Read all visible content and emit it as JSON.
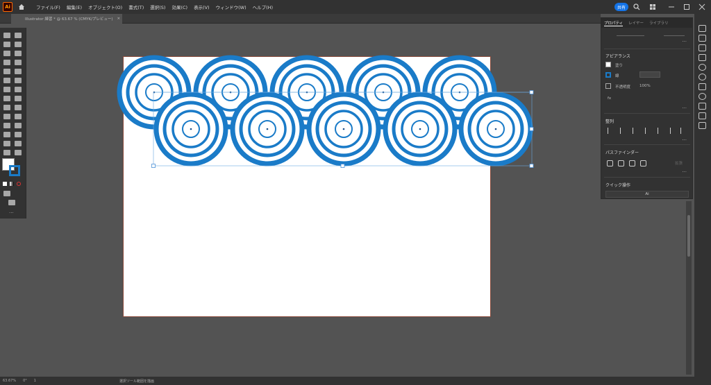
{
  "app": {
    "logo": "Ai"
  },
  "menu": {
    "items": [
      "ファイル(F)",
      "編集(E)",
      "オブジェクト(O)",
      "書式(T)",
      "選択(S)",
      "効果(C)",
      "表示(V)",
      "ウィンドウ(W)",
      "ヘルプ(H)"
    ]
  },
  "topbar": {
    "share_label": "共有",
    "search_icon": "search-icon"
  },
  "tab": {
    "title": "Illustrator 練習 * @ 63.67 % (CMYK/プレビュー)",
    "close": "×"
  },
  "panel": {
    "tabs": [
      "プロパティ",
      "レイヤー",
      "ライブラリ"
    ],
    "appearance_title": "アピアランス",
    "fill_label": "塗り",
    "stroke_label": "線",
    "opacity_label": "不透明度",
    "opacity_value": "100%",
    "fx_label": "fx",
    "align_title": "整列",
    "pathfinder_title": "パスファインダー",
    "pathfinder_extra": "拡張",
    "quick_actions_title": "クイック操作",
    "quick_action_button": "Ai"
  },
  "status": {
    "zoom": "63.67%",
    "rotation": "0°",
    "page": "1",
    "tool_hint": "選択ツール範囲を描画"
  },
  "colors": {
    "stroke_blue": "#1a7bc8",
    "artboard_border": "#8a4a3a",
    "accent": "#1473e6"
  }
}
